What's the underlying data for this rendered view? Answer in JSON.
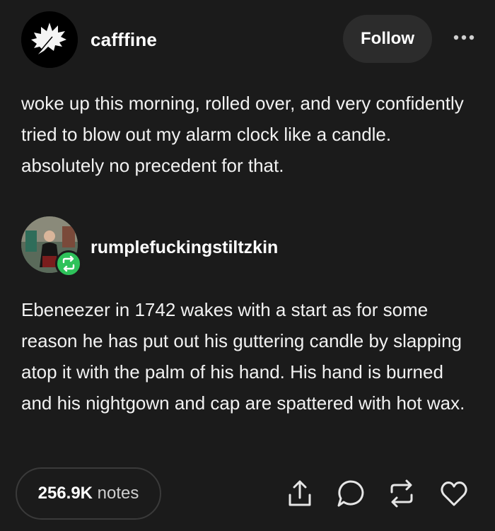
{
  "post": {
    "username": "cafffine",
    "follow_label": "Follow",
    "text": "woke up this morning, rolled over, and very confidently tried to blow out my alarm clock like a candle. absolutely no precedent for that."
  },
  "reblog": {
    "username": "rumplefuckingstiltzkin",
    "text": "Ebeneezer in 1742 wakes with a start as for some reason he has put out his guttering candle by slapping atop it with the palm of his hand. His hand is burned and his nightgown and cap are spattered with hot wax."
  },
  "footer": {
    "notes_count": "256.9K",
    "notes_label": "notes"
  },
  "icons": {
    "menu": "more-dots-icon",
    "share": "share-icon",
    "reply": "reply-icon",
    "reblog": "reblog-icon",
    "like": "heart-icon"
  },
  "colors": {
    "background": "#1b1b1b",
    "button": "#2c2c2c",
    "reblog_badge": "#2ec25a",
    "text": "#f2f2f2"
  }
}
